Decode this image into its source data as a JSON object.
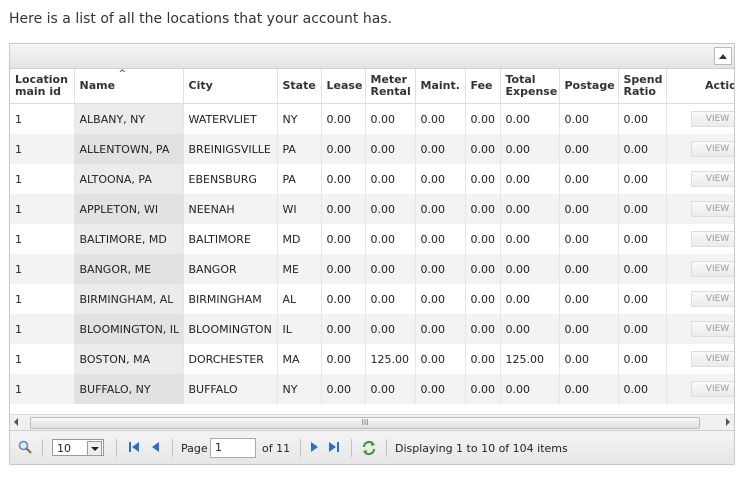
{
  "intro_text": "Here is a list of all the locations that your account has.",
  "columns": {
    "location_main_id": "Location main id",
    "name": "Name",
    "city": "City",
    "state": "State",
    "lease": "Lease",
    "meter_rental": "Meter Rental",
    "maint": "Maint.",
    "fee": "Fee",
    "total_expense": "Total Expense",
    "postage": "Postage",
    "spend_ratio": "Spend Ratio",
    "action": "Action"
  },
  "rows": [
    {
      "id": "1",
      "name": "ALBANY, NY",
      "city": "WATERVLIET",
      "state": "NY",
      "lease": "0.00",
      "meter": "0.00",
      "maint": "0.00",
      "fee": "0.00",
      "total": "0.00",
      "postage": "0.00",
      "ratio": "0.00",
      "action": "VIEW"
    },
    {
      "id": "1",
      "name": "ALLENTOWN, PA",
      "city": "BREINIGSVILLE",
      "state": "PA",
      "lease": "0.00",
      "meter": "0.00",
      "maint": "0.00",
      "fee": "0.00",
      "total": "0.00",
      "postage": "0.00",
      "ratio": "0.00",
      "action": "VIEW"
    },
    {
      "id": "1",
      "name": "ALTOONA, PA",
      "city": "EBENSBURG",
      "state": "PA",
      "lease": "0.00",
      "meter": "0.00",
      "maint": "0.00",
      "fee": "0.00",
      "total": "0.00",
      "postage": "0.00",
      "ratio": "0.00",
      "action": "VIEW"
    },
    {
      "id": "1",
      "name": "APPLETON, WI",
      "city": "NEENAH",
      "state": "WI",
      "lease": "0.00",
      "meter": "0.00",
      "maint": "0.00",
      "fee": "0.00",
      "total": "0.00",
      "postage": "0.00",
      "ratio": "0.00",
      "action": "VIEW"
    },
    {
      "id": "1",
      "name": "BALTIMORE, MD",
      "city": "BALTIMORE",
      "state": "MD",
      "lease": "0.00",
      "meter": "0.00",
      "maint": "0.00",
      "fee": "0.00",
      "total": "0.00",
      "postage": "0.00",
      "ratio": "0.00",
      "action": "VIEW"
    },
    {
      "id": "1",
      "name": "BANGOR, ME",
      "city": "BANGOR",
      "state": "ME",
      "lease": "0.00",
      "meter": "0.00",
      "maint": "0.00",
      "fee": "0.00",
      "total": "0.00",
      "postage": "0.00",
      "ratio": "0.00",
      "action": "VIEW"
    },
    {
      "id": "1",
      "name": "BIRMINGHAM, AL",
      "city": "BIRMINGHAM",
      "state": "AL",
      "lease": "0.00",
      "meter": "0.00",
      "maint": "0.00",
      "fee": "0.00",
      "total": "0.00",
      "postage": "0.00",
      "ratio": "0.00",
      "action": "VIEW"
    },
    {
      "id": "1",
      "name": "BLOOMINGTON, IL",
      "city": "BLOOMINGTON",
      "state": "IL",
      "lease": "0.00",
      "meter": "0.00",
      "maint": "0.00",
      "fee": "0.00",
      "total": "0.00",
      "postage": "0.00",
      "ratio": "0.00",
      "action": "VIEW"
    },
    {
      "id": "1",
      "name": "BOSTON, MA",
      "city": "DORCHESTER",
      "state": "MA",
      "lease": "0.00",
      "meter": "125.00",
      "maint": "0.00",
      "fee": "0.00",
      "total": "125.00",
      "postage": "0.00",
      "ratio": "0.00",
      "action": "VIEW"
    },
    {
      "id": "1",
      "name": "BUFFALO, NY",
      "city": "BUFFALO",
      "state": "NY",
      "lease": "0.00",
      "meter": "0.00",
      "maint": "0.00",
      "fee": "0.00",
      "total": "0.00",
      "postage": "0.00",
      "ratio": "0.00",
      "action": "VIEW"
    }
  ],
  "pager": {
    "page_size": "10",
    "page_label": "Page",
    "page_value": "1",
    "of_label": "of 11",
    "display_text": "Displaying 1 to 10 of 104 items"
  },
  "scroll_grip": "III",
  "icons": {
    "search": "search-icon",
    "first": "first-page-icon",
    "prev": "prev-page-icon",
    "next": "next-page-icon",
    "last": "last-page-icon",
    "refresh": "refresh-icon"
  },
  "colors": {
    "nav_blue": "#2a6fc9",
    "refresh_green": "#3a9a3a"
  }
}
